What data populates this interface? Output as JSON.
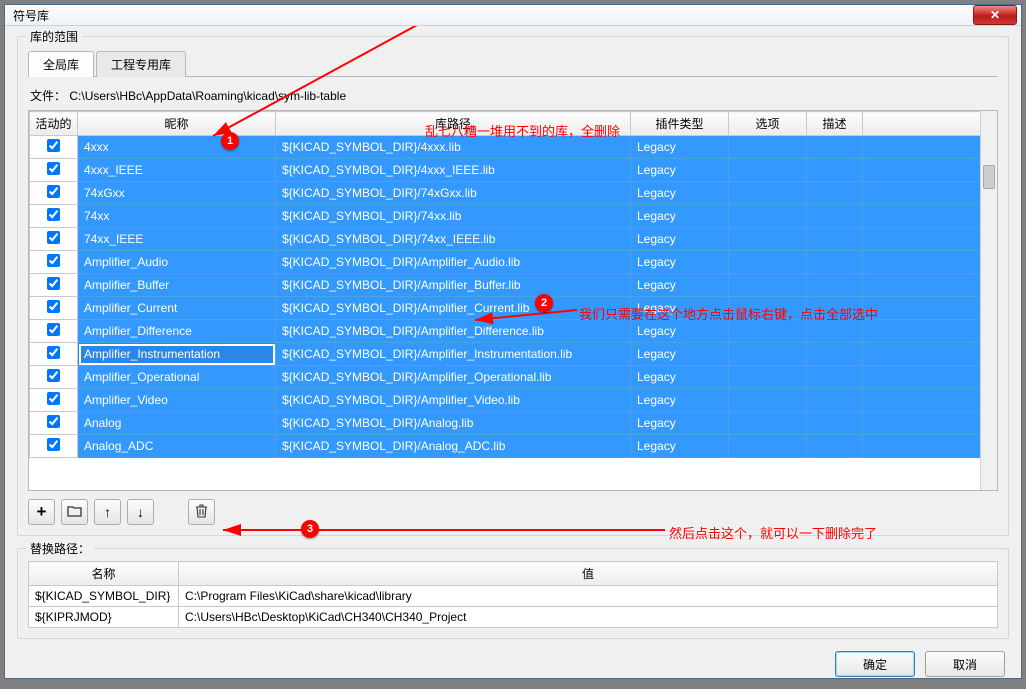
{
  "window": {
    "title": "符号库"
  },
  "group1": {
    "label": "库的范围",
    "tabs": {
      "global": "全局库",
      "project": "工程专用库"
    },
    "file_prefix": "文件：",
    "file_path": "C:\\Users\\HBc\\AppData\\Roaming\\kicad\\sym-lib-table",
    "columns": {
      "active": "活动的",
      "nick": "昵称",
      "path": "库路径",
      "plugin": "插件类型",
      "options": "选项",
      "desc": "描述"
    },
    "rows": [
      {
        "active": true,
        "nick": "4xxx",
        "path": "${KICAD_SYMBOL_DIR}/4xxx.lib",
        "plugin": "Legacy",
        "options": "",
        "desc": ""
      },
      {
        "active": true,
        "nick": "4xxx_IEEE",
        "path": "${KICAD_SYMBOL_DIR}/4xxx_IEEE.lib",
        "plugin": "Legacy",
        "options": "",
        "desc": ""
      },
      {
        "active": true,
        "nick": "74xGxx",
        "path": "${KICAD_SYMBOL_DIR}/74xGxx.lib",
        "plugin": "Legacy",
        "options": "",
        "desc": ""
      },
      {
        "active": true,
        "nick": "74xx",
        "path": "${KICAD_SYMBOL_DIR}/74xx.lib",
        "plugin": "Legacy",
        "options": "",
        "desc": ""
      },
      {
        "active": true,
        "nick": "74xx_IEEE",
        "path": "${KICAD_SYMBOL_DIR}/74xx_IEEE.lib",
        "plugin": "Legacy",
        "options": "",
        "desc": ""
      },
      {
        "active": true,
        "nick": "Amplifier_Audio",
        "path": "${KICAD_SYMBOL_DIR}/Amplifier_Audio.lib",
        "plugin": "Legacy",
        "options": "",
        "desc": ""
      },
      {
        "active": true,
        "nick": "Amplifier_Buffer",
        "path": "${KICAD_SYMBOL_DIR}/Amplifier_Buffer.lib",
        "plugin": "Legacy",
        "options": "",
        "desc": ""
      },
      {
        "active": true,
        "nick": "Amplifier_Current",
        "path": "${KICAD_SYMBOL_DIR}/Amplifier_Current.lib",
        "plugin": "Legacy",
        "options": "",
        "desc": ""
      },
      {
        "active": true,
        "nick": "Amplifier_Difference",
        "path": "${KICAD_SYMBOL_DIR}/Amplifier_Difference.lib",
        "plugin": "Legacy",
        "options": "",
        "desc": ""
      },
      {
        "active": true,
        "nick": "Amplifier_Instrumentation",
        "path": "${KICAD_SYMBOL_DIR}/Amplifier_Instrumentation.lib",
        "plugin": "Legacy",
        "options": "",
        "desc": "",
        "focused": true
      },
      {
        "active": true,
        "nick": "Amplifier_Operational",
        "path": "${KICAD_SYMBOL_DIR}/Amplifier_Operational.lib",
        "plugin": "Legacy",
        "options": "",
        "desc": ""
      },
      {
        "active": true,
        "nick": "Amplifier_Video",
        "path": "${KICAD_SYMBOL_DIR}/Amplifier_Video.lib",
        "plugin": "Legacy",
        "options": "",
        "desc": ""
      },
      {
        "active": true,
        "nick": "Analog",
        "path": "${KICAD_SYMBOL_DIR}/Analog.lib",
        "plugin": "Legacy",
        "options": "",
        "desc": ""
      },
      {
        "active": true,
        "nick": "Analog_ADC",
        "path": "${KICAD_SYMBOL_DIR}/Analog_ADC.lib",
        "plugin": "Legacy",
        "options": "",
        "desc": ""
      }
    ]
  },
  "toolbar": {
    "add": "+",
    "browse": "folder",
    "up": "↑",
    "down": "↓",
    "delete": "trash"
  },
  "group2": {
    "label": "替换路径：",
    "columns": {
      "name": "名称",
      "value": "值"
    },
    "rows": [
      {
        "name": "${KICAD_SYMBOL_DIR}",
        "value": "C:\\Program Files\\KiCad\\share\\kicad\\library"
      },
      {
        "name": "${KIPRJMOD}",
        "value": "C:\\Users\\HBc\\Desktop\\KiCad\\CH340\\CH340_Project"
      }
    ]
  },
  "buttons": {
    "ok": "确定",
    "cancel": "取消"
  },
  "annotations": {
    "top": "乱七八糟一堆用不到的库，全删除",
    "mid": "我们只需要在这个地方点击鼠标右键，点击全部选中",
    "bot": "然后点击这个，就可以一下删除完了"
  }
}
